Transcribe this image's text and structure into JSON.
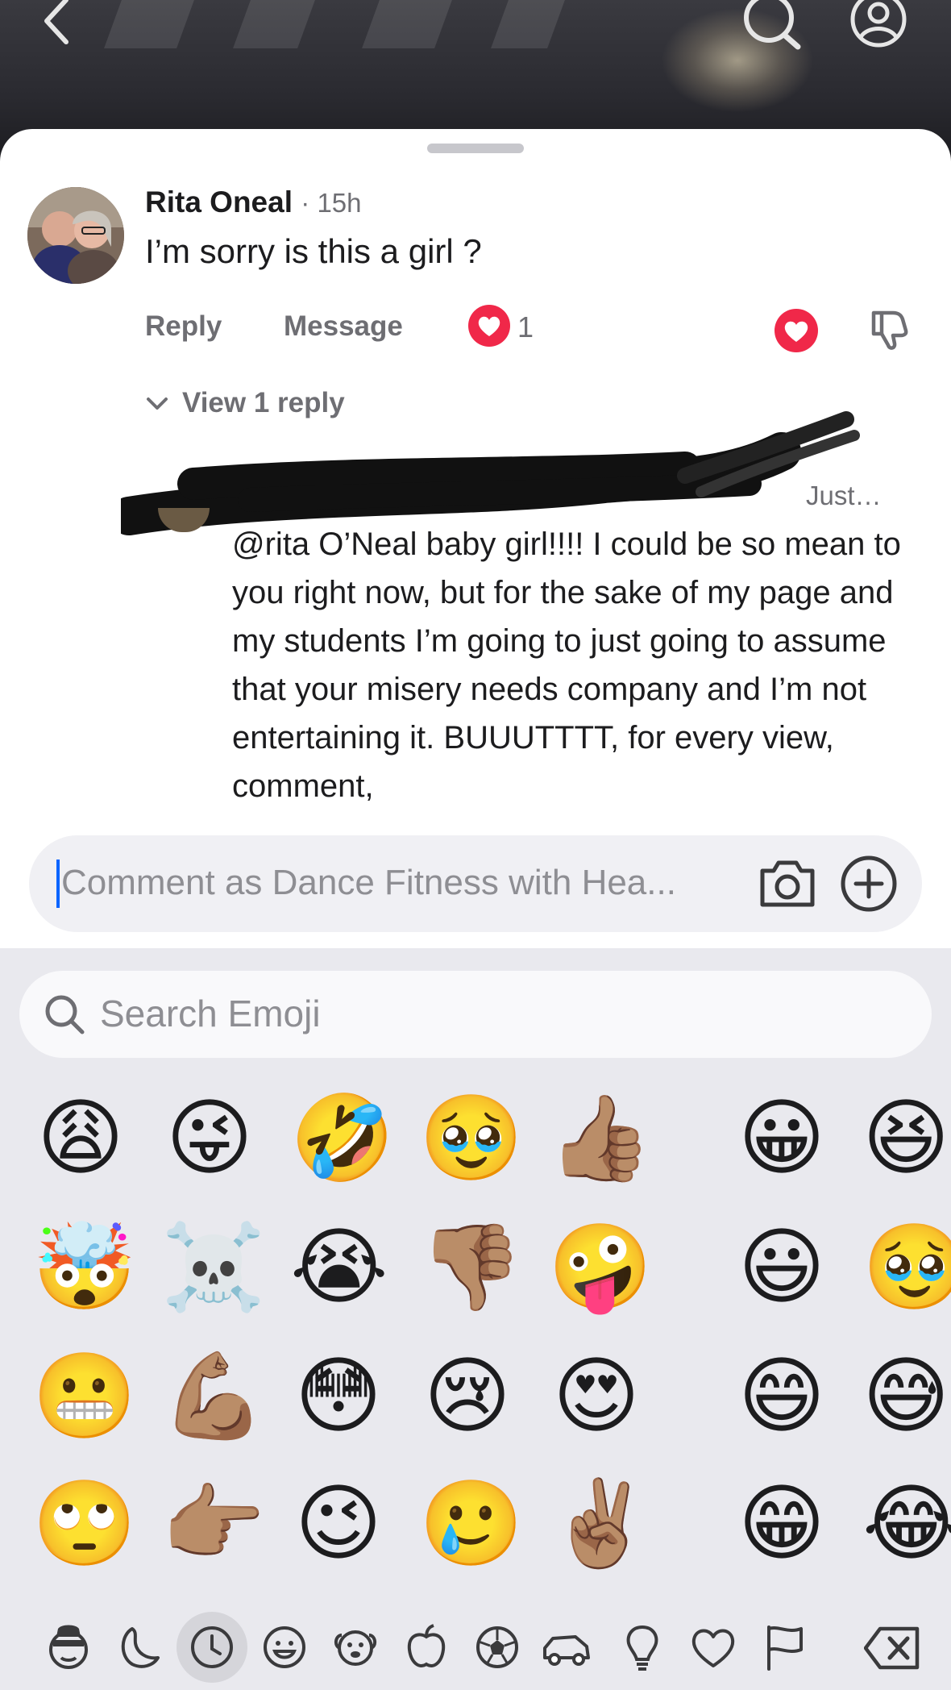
{
  "comment": {
    "author": "Rita Oneal",
    "time": "· 15h",
    "text": "I’m sorry is this a girl ?",
    "actions": {
      "reply": "Reply",
      "message": "Message",
      "like_count": "1"
    },
    "view_replies": "View 1 reply"
  },
  "reply": {
    "meta_visible": "Just…",
    "text": "@rita O’Neal baby girl!!!! I could be so mean to you right now, but for the sake of my page and my students I’m going to just going to assume that your misery needs company and I’m not entertaining it. BUUUTTTT, for every view, comment,"
  },
  "input": {
    "placeholder": "Comment as Dance Fitness with Hea..."
  },
  "emoji_keyboard": {
    "search_placeholder": "Search Emoji",
    "emojis": [
      [
        "😩",
        "😜",
        "🤣",
        "🥹",
        "👍🏽",
        "😀",
        "😆"
      ],
      [
        "🤯",
        "☠️",
        "😭",
        "👎🏽",
        "🤪",
        "😃",
        "🥹"
      ],
      [
        "😬",
        "💪🏽",
        "😳",
        "😢",
        "😍",
        "😄",
        "😅"
      ],
      [
        "🙄",
        "👉🏽",
        "😉",
        "🥲",
        "✌🏽",
        "😁",
        "😂"
      ]
    ],
    "categories": [
      "memoji-icon",
      "crescent-moon-icon",
      "recent-clock-icon",
      "smiley-icon",
      "animal-icon",
      "apple-food-icon",
      "soccer-ball-icon",
      "car-icon",
      "lightbulb-icon",
      "heart-icon",
      "flag-icon",
      "backspace-icon"
    ]
  },
  "colors": {
    "accent_blue": "#0a64ff",
    "heart_red": "#f02849"
  }
}
